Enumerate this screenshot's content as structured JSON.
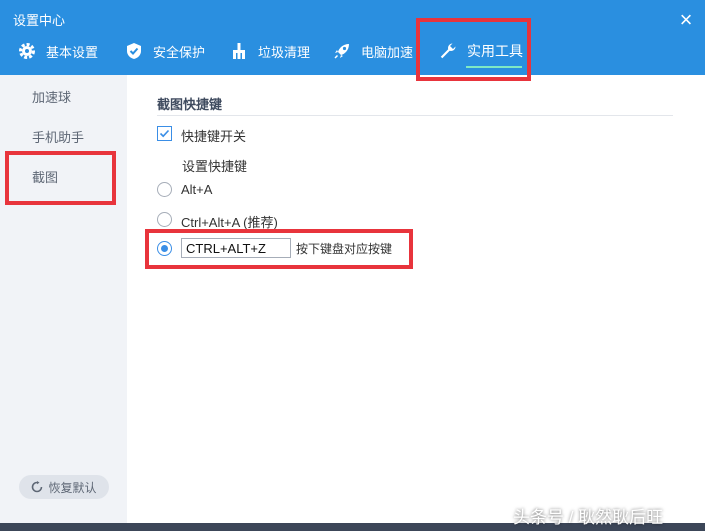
{
  "window": {
    "title": "设置中心",
    "close_symbol": "×"
  },
  "tabs": [
    {
      "label": "基本设置",
      "icon": "gear-icon"
    },
    {
      "label": "安全保护",
      "icon": "shield-icon"
    },
    {
      "label": "垃圾清理",
      "icon": "broom-icon"
    },
    {
      "label": "电脑加速",
      "icon": "rocket-icon"
    },
    {
      "label": "实用工具",
      "icon": "wrench-icon",
      "active": true
    }
  ],
  "sidebar": {
    "items": [
      {
        "label": "加速球"
      },
      {
        "label": "手机助手"
      },
      {
        "label": "截图",
        "active": true
      }
    ],
    "reset_label": "恢复默认"
  },
  "screenshot": {
    "section_title": "截图快捷键",
    "hotkey_toggle": {
      "label": "快捷键开关",
      "checked": true
    },
    "set_hotkey_label": "设置快捷键",
    "options": [
      {
        "label": "Alt+A",
        "selected": false
      },
      {
        "label": "Ctrl+Alt+A (推荐)",
        "selected": false
      }
    ],
    "custom": {
      "selected": true,
      "value": "CTRL+ALT+Z",
      "hint": "按下键盘对应按键"
    }
  },
  "watermark": "头条号 / 耿然耿后旺",
  "colors": {
    "header": "#2a8fe0",
    "accent": "#3a8ee6",
    "highlight": "#e8343c",
    "tab_underline": "#7fe9c4"
  }
}
